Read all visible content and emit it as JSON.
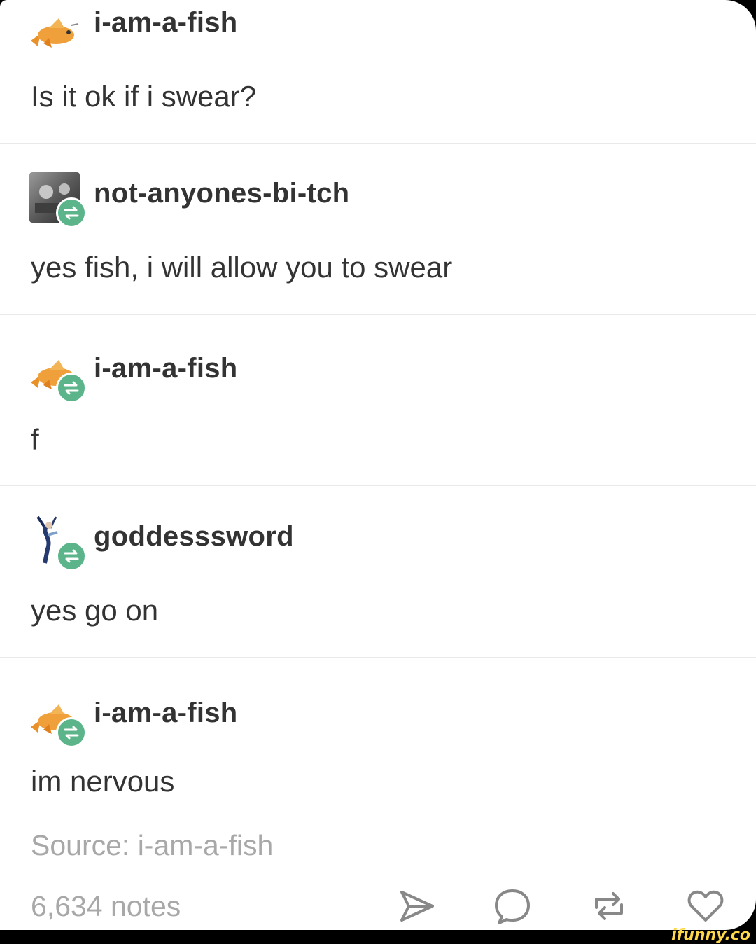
{
  "posts": [
    {
      "username": "i-am-a-fish",
      "text": "Is it ok if i swear?",
      "avatar": "goldfish-avatar",
      "reblogged": false
    },
    {
      "username": "not-anyones-bi-tch",
      "text": "yes fish, i will allow you to swear",
      "avatar": "photo-avatar",
      "reblogged": true
    },
    {
      "username": "i-am-a-fish",
      "text": "f",
      "avatar": "goldfish-avatar",
      "reblogged": true
    },
    {
      "username": "goddesssword",
      "text": "yes go on",
      "avatar": "figure-avatar",
      "reblogged": true
    },
    {
      "username": "i-am-a-fish",
      "text": "im nervous",
      "avatar": "goldfish-avatar",
      "reblogged": true
    }
  ],
  "footer": {
    "source": "Source: i-am-a-fish",
    "notes": "6,634 notes",
    "actions": [
      "share-icon",
      "reply-icon",
      "reblog-icon",
      "like-icon"
    ]
  },
  "watermark": "ifunny.co",
  "colors": {
    "reblog_badge": "#5cb58a",
    "muted_text": "#a8a8a8",
    "text": "#333333"
  }
}
